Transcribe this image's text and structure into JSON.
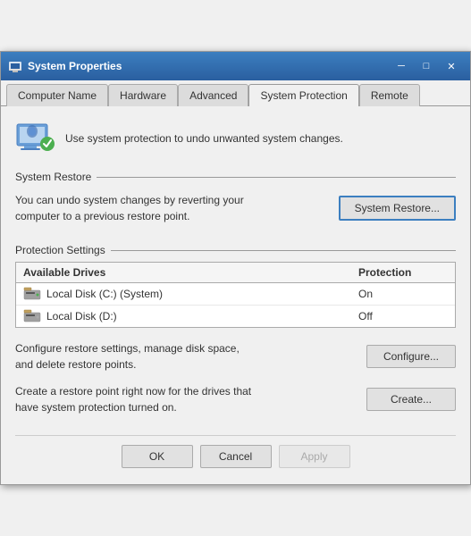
{
  "window": {
    "title": "System Properties",
    "close_label": "✕",
    "minimize_label": "─",
    "maximize_label": "□"
  },
  "tabs": [
    {
      "id": "computer-name",
      "label": "Computer Name",
      "active": false
    },
    {
      "id": "hardware",
      "label": "Hardware",
      "active": false
    },
    {
      "id": "advanced",
      "label": "Advanced",
      "active": false
    },
    {
      "id": "system-protection",
      "label": "System Protection",
      "active": true
    },
    {
      "id": "remote",
      "label": "Remote",
      "active": false
    }
  ],
  "top_info": {
    "text": "Use system protection to undo unwanted system changes."
  },
  "system_restore": {
    "section_title": "System Restore",
    "description": "You can undo system changes by reverting your computer to a previous restore point.",
    "button_label": "System Restore..."
  },
  "protection_settings": {
    "section_title": "Protection Settings",
    "columns": [
      "Available Drives",
      "Protection"
    ],
    "drives": [
      {
        "name": "Local Disk (C:) (System)",
        "protection": "On"
      },
      {
        "name": "Local Disk (D:)",
        "protection": "Off"
      }
    ],
    "configure_text": "Configure restore settings, manage disk space, and delete restore points.",
    "configure_button": "Configure...",
    "create_text": "Create a restore point right now for the drives that have system protection turned on.",
    "create_button": "Create..."
  },
  "footer": {
    "ok_label": "OK",
    "cancel_label": "Cancel",
    "apply_label": "Apply"
  }
}
